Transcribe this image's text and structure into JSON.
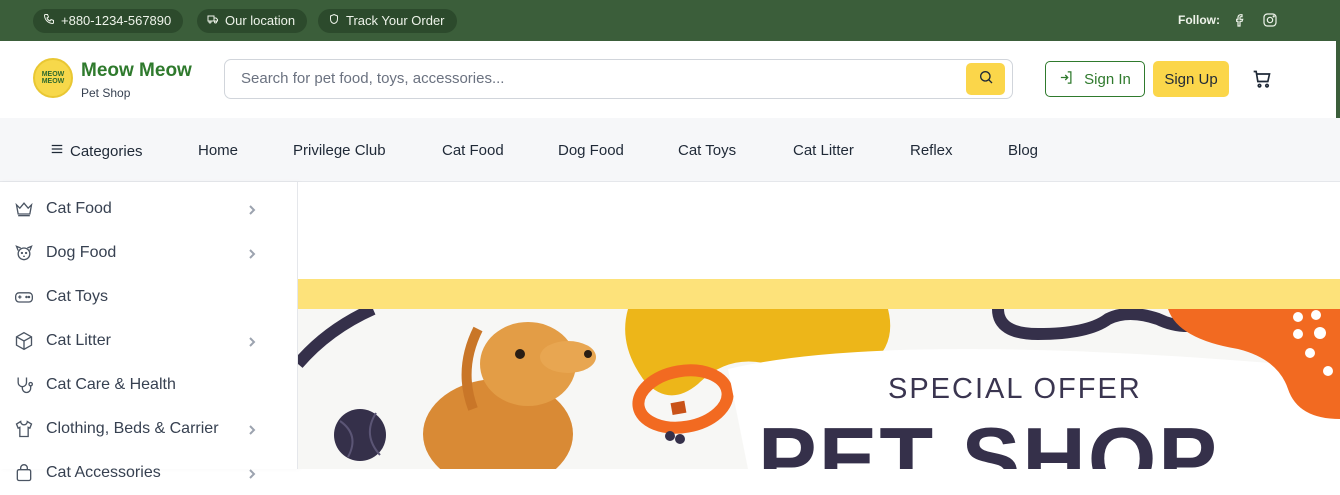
{
  "topbar": {
    "phone": "+880-1234-567890",
    "location": "Our location",
    "track": "Track Your Order",
    "follow": "Follow:",
    "social": [
      "facebook-icon",
      "instagram-icon"
    ]
  },
  "header": {
    "logo_text_line1": "MEOW",
    "logo_text_line2": "MEOW",
    "brand": "Meow Meow",
    "brand_sub": "Pet Shop",
    "search_placeholder": "Search for pet food, toys, accessories...",
    "signin": "Sign In",
    "signup": "Sign Up"
  },
  "nav": {
    "categories": "Categories",
    "items": [
      "Home",
      "Privilege Club",
      "Cat Food",
      "Dog Food",
      "Cat Toys",
      "Cat Litter",
      "Reflex",
      "Blog"
    ]
  },
  "sidebar": {
    "items": [
      {
        "label": "Cat Food",
        "icon": "crown-icon",
        "has_sub": true
      },
      {
        "label": "Dog Food",
        "icon": "dog-icon",
        "has_sub": true
      },
      {
        "label": "Cat Toys",
        "icon": "gamepad-icon",
        "has_sub": false
      },
      {
        "label": "Cat Litter",
        "icon": "box-icon",
        "has_sub": true
      },
      {
        "label": "Cat Care & Health",
        "icon": "stethoscope-icon",
        "has_sub": false
      },
      {
        "label": "Clothing, Beds & Carrier",
        "icon": "shirt-icon",
        "has_sub": true
      },
      {
        "label": "Cat Accessories",
        "icon": "bag-icon",
        "has_sub": true
      }
    ]
  },
  "banner": {
    "offer": "SPECIAL OFFER",
    "title": "PET SHOP"
  },
  "colors": {
    "topbar": "#3b5e3a",
    "brand_green": "#2f7a2d",
    "accent_yellow": "#fbd64a",
    "banner_orange": "#f26a21",
    "banner_dark": "#35304a"
  }
}
